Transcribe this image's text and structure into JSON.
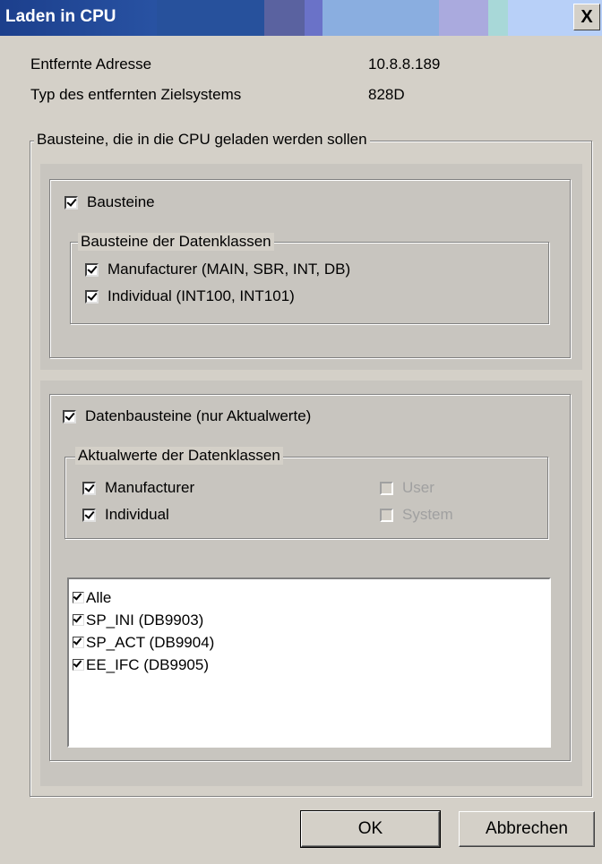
{
  "window": {
    "title": "Laden in CPU",
    "close_glyph": "X"
  },
  "info": {
    "address_label": "Entfernte Adresse",
    "address_value": "10.8.8.189",
    "target_label": "Typ des entfernten Zielsystems",
    "target_value": "828D"
  },
  "main_group": {
    "legend": "Bausteine, die in die CPU geladen werden sollen"
  },
  "bausteine": {
    "label": "Bausteine",
    "checked": true,
    "classes_legend": "Bausteine der Datenklassen",
    "items": [
      {
        "label": "Manufacturer  (MAIN, SBR, INT, DB)",
        "checked": true
      },
      {
        "label": "Individual  (INT100, INT101)",
        "checked": true
      }
    ]
  },
  "datenbausteine": {
    "label": "Datenbausteine (nur Aktualwerte)",
    "checked": true,
    "classes_legend": "Aktualwerte der Datenklassen",
    "left": [
      {
        "label": "Manufacturer",
        "checked": true
      },
      {
        "label": "Individual",
        "checked": true
      }
    ],
    "right": [
      {
        "label": "User",
        "checked": false,
        "disabled": true
      },
      {
        "label": "System",
        "checked": false,
        "disabled": true
      }
    ],
    "list": [
      {
        "label": "Alle",
        "checked": true
      },
      {
        "label": "SP_INI (DB9903)",
        "checked": true
      },
      {
        "label": "SP_ACT (DB9904)",
        "checked": true
      },
      {
        "label": "EE_IFC (DB9905)",
        "checked": true
      }
    ]
  },
  "buttons": {
    "ok": "OK",
    "cancel": "Abbrechen"
  },
  "colors": {
    "titlebar_start": "#1c3f8c",
    "dialog_bg": "#d4d0c8"
  }
}
